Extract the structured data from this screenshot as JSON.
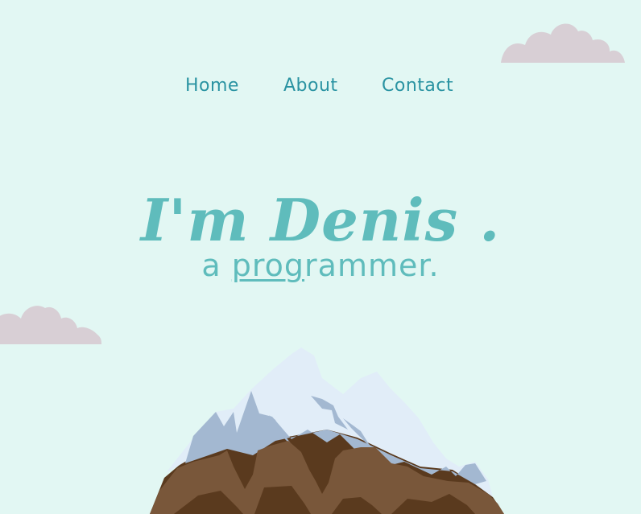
{
  "nav": {
    "items": [
      {
        "label": "Home"
      },
      {
        "label": "About"
      },
      {
        "label": "Contact"
      }
    ]
  },
  "hero": {
    "title": "I'm Denis .",
    "subtitle_prefix": "a ",
    "subtitle_underlined": "prog",
    "subtitle_suffix": "rammer."
  },
  "colors": {
    "background": "#e2f7f3",
    "nav_text": "#2a93a2",
    "accent_teal": "#5fbcbc",
    "cloud": "#d8cfd5",
    "snow_light": "#e1edf8",
    "snow_shadow": "#a3b8d1",
    "rock": "#79573a",
    "rock_dark": "#5a3a1e"
  },
  "icons": {
    "cloud_top": "cloud-icon",
    "cloud_left": "cloud-icon",
    "mountain": "mountain-illustration"
  }
}
